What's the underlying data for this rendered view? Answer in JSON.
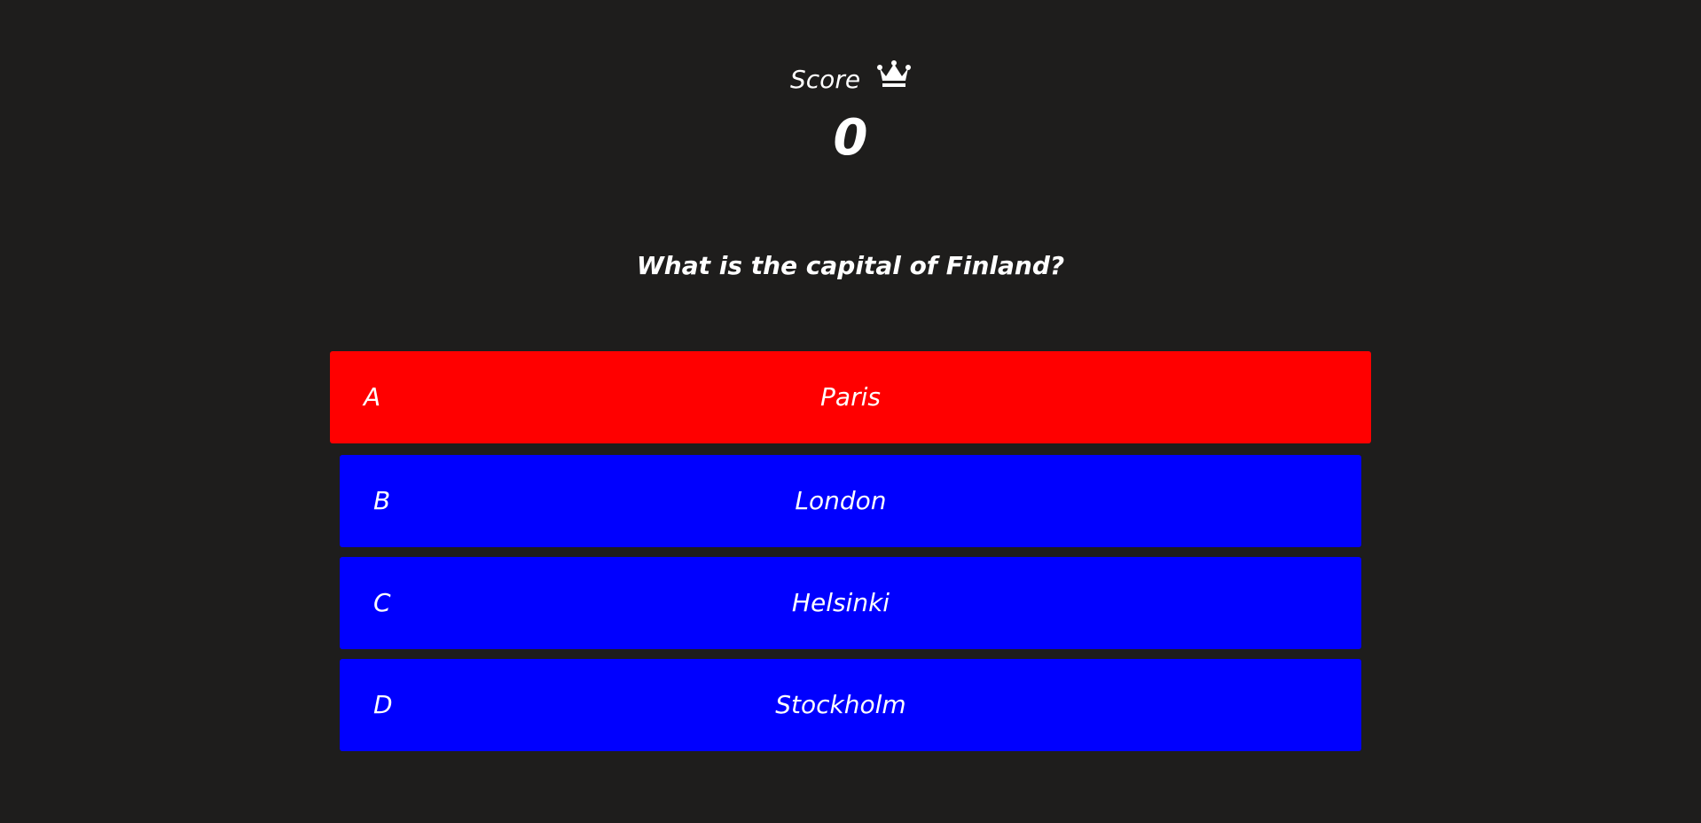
{
  "score": {
    "label": "Score",
    "icon": "crown-icon",
    "value": "0"
  },
  "question": {
    "text": "What is the capital of Finland?"
  },
  "answers": [
    {
      "letter": "A",
      "text": "Paris",
      "state": "selected-wrong",
      "color": "#ff0000"
    },
    {
      "letter": "B",
      "text": "London",
      "state": "default",
      "color": "#0000ff"
    },
    {
      "letter": "C",
      "text": "Helsinki",
      "state": "default",
      "color": "#0000ff"
    },
    {
      "letter": "D",
      "text": "Stockholm",
      "state": "default",
      "color": "#0000ff"
    }
  ],
  "colors": {
    "background": "#1e1d1c",
    "text": "#ffffff",
    "wrong": "#ff0000",
    "option": "#0000ff"
  }
}
